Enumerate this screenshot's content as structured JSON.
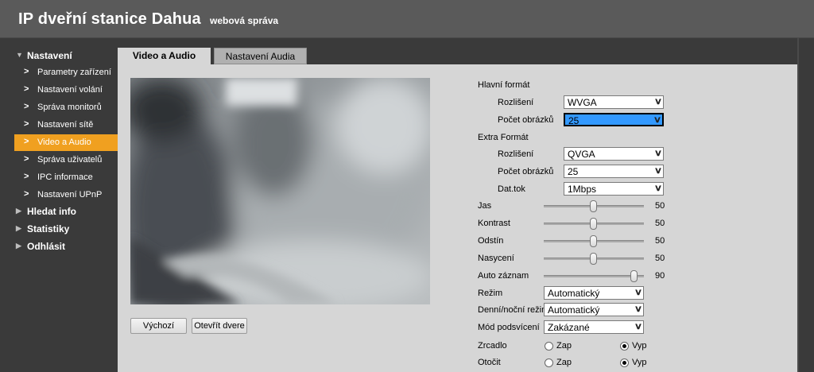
{
  "header": {
    "title": "IP dveřní stanice Dahua",
    "subtitle": "webová správa"
  },
  "sidebar": {
    "items": [
      {
        "label": "Nastavení",
        "level": "top",
        "expanded": true
      },
      {
        "label": "Parametry zařízení",
        "level": "sub"
      },
      {
        "label": "Nastavení volání",
        "level": "sub"
      },
      {
        "label": "Správa monitorů",
        "level": "sub"
      },
      {
        "label": "Nastavení sítě",
        "level": "sub"
      },
      {
        "label": "Video a Audio",
        "level": "sub",
        "active": true
      },
      {
        "label": "Správa uživatelů",
        "level": "sub"
      },
      {
        "label": "IPC informace",
        "level": "sub"
      },
      {
        "label": "Nastavení UPnP",
        "level": "sub"
      },
      {
        "label": "Hledat info",
        "level": "top"
      },
      {
        "label": "Statistiky",
        "level": "top"
      },
      {
        "label": "Odhlásit",
        "level": "top"
      }
    ],
    "active_color": "#f0a020"
  },
  "tabs": [
    {
      "label": "Video a Audio",
      "active": true
    },
    {
      "label": "Nastavení Audia",
      "active": false
    }
  ],
  "buttons": {
    "default": "Výchozí",
    "open_door": "Otevřít dvere"
  },
  "main_format": {
    "heading": "Hlavní formát",
    "resolution_label": "Rozlišení",
    "resolution": "WVGA",
    "fps_label": "Počet obrázků",
    "fps": "25"
  },
  "extra_format": {
    "heading": "Extra Formát",
    "resolution_label": "Rozlišení",
    "resolution": "QVGA",
    "fps_label": "Počet obrázků",
    "fps": "25",
    "bitrate_label": "Dat.tok",
    "bitrate": "1Mbps"
  },
  "sliders": [
    {
      "label": "Jas",
      "value": 50
    },
    {
      "label": "Kontrast",
      "value": 50
    },
    {
      "label": "Odstín",
      "value": 50
    },
    {
      "label": "Nasycení",
      "value": 50
    },
    {
      "label": "Auto záznam",
      "value": 90
    }
  ],
  "selects": [
    {
      "label": "Režim",
      "value": "Automatický"
    },
    {
      "label": "Denní/noční režim",
      "value": "Automatický"
    },
    {
      "label": "Mód podsvícení",
      "value": "Zakázané"
    }
  ],
  "radios": [
    {
      "label": "Zrcadlo",
      "on": "Zap",
      "off": "Vyp",
      "selected": "Vyp"
    },
    {
      "label": "Otočit",
      "on": "Zap",
      "off": "Vyp",
      "selected": "Vyp"
    }
  ],
  "colors": {
    "header_bg": "#5a5a5a",
    "panel_bg": "#d6d6d6",
    "highlight": "#3399ff"
  }
}
